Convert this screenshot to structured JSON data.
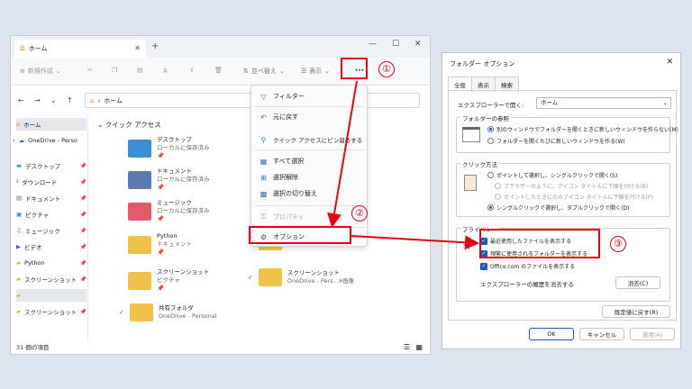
{
  "explorer": {
    "tab_title": "ホーム",
    "toolbar": {
      "new": "新規作成",
      "sort": "並べ替え",
      "view": "表示",
      "more": "···"
    },
    "address": "ホーム",
    "sidebar": [
      {
        "label": "ホーム",
        "icon": "home-icon"
      },
      {
        "label": "OneDrive - Perso",
        "icon": "cloud-icon"
      },
      {
        "label": "デスクトップ",
        "icon": "desktop-icon"
      },
      {
        "label": "ダウンロード",
        "icon": "download-icon"
      },
      {
        "label": "ドキュメント",
        "icon": "document-icon"
      },
      {
        "label": "ピクチャ",
        "icon": "picture-icon"
      },
      {
        "label": "ミュージック",
        "icon": "music-icon"
      },
      {
        "label": "ビデオ",
        "icon": "video-icon"
      },
      {
        "label": "Python",
        "icon": "folder-icon"
      },
      {
        "label": "スクリーンショット",
        "icon": "folder-icon"
      },
      {
        "label": "",
        "icon": "folder-icon"
      },
      {
        "label": "スクリーンショット",
        "icon": "folder-icon"
      }
    ],
    "quick_access_heading": "クイック アクセス",
    "items": [
      {
        "name": "デスクトップ",
        "sub": "ローカルに保存済み"
      },
      {
        "name": "ドキュメント",
        "sub": "ローカルに保存済み"
      },
      {
        "name": "ミュージック",
        "sub": "ローカルに保存済み"
      },
      {
        "name": "Python",
        "sub": "ドキュメント"
      },
      {
        "name": "スクリーンショット",
        "sub": "ピクチャ"
      },
      {
        "name": "共有フォルダ",
        "sub": "OneDrive - Personal"
      },
      {
        "name": "スクリーンショット",
        "sub": "OneDrive - Pers...¥画像"
      }
    ],
    "status": "31 個の項目"
  },
  "menu": {
    "items": [
      {
        "label": "フィルター",
        "icon": "filter-icon"
      },
      {
        "label": "元に戻す",
        "icon": "undo-icon"
      },
      {
        "label": "クイック アクセスにピン留めする",
        "icon": "pin-icon"
      },
      {
        "label": "すべて選択",
        "icon": "select-all-icon"
      },
      {
        "label": "選択解除",
        "icon": "select-none-icon"
      },
      {
        "label": "選択の切り替え",
        "icon": "invert-selection-icon"
      },
      {
        "label": "プロパティ",
        "icon": "properties-icon"
      },
      {
        "label": "オプション",
        "icon": "options-icon"
      }
    ]
  },
  "dialog": {
    "title": "フォルダー オプション",
    "tabs": [
      "全般",
      "表示",
      "検索"
    ],
    "open_label": "エクスプローラーで開く:",
    "open_value": "ホーム",
    "browse_group": "フォルダーの参照",
    "browse_opt1": "別のウィンドウでフォルダーを開くときに新しいウィンドウを作らない(M)",
    "browse_opt2": "フォルダーを開くたびに新しいウィンドウを作る(W)",
    "click_group": "クリック方法",
    "click_opt1": "ポイントして選択し、シングルクリックで開く(S)",
    "click_opt1a": "ブラウザーのように、アイコン タイトルに下線を付ける(B)",
    "click_opt1b": "ポイントしたときにのみアイコン タイトルに下線を付ける(P)",
    "click_opt2": "シングルクリックで選択し、ダブルクリックで開く(D)",
    "privacy_group": "プライバシー",
    "privacy_chk1": "最近使用したファイルを表示する",
    "privacy_chk2": "頻繁に使用されるフォルダーを表示する",
    "privacy_chk3": "Office.com のファイルを表示する",
    "clear_label": "エクスプローラーの履歴を消去する",
    "clear_btn": "消去(C)",
    "restore_btn": "既定値に戻す(R)",
    "ok": "OK",
    "cancel": "キャンセル",
    "apply": "適用(A)"
  },
  "annotations": {
    "n1": "①",
    "n2": "②",
    "n3": "③",
    "color": "#e60012"
  }
}
